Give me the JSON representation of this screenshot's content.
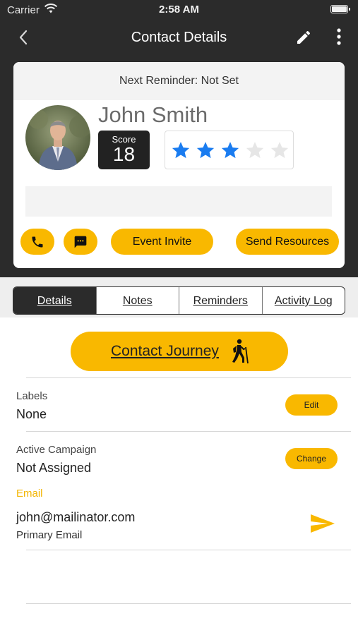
{
  "status_bar": {
    "carrier": "Carrier",
    "time": "2:58 AM"
  },
  "nav": {
    "title": "Contact Details"
  },
  "card": {
    "reminder": "Next Reminder:  Not Set",
    "name": "John Smith",
    "score_label": "Score",
    "score_value": "18",
    "rating": 3,
    "rating_max": 5,
    "event_invite": "Event Invite",
    "send_resources": "Send Resources"
  },
  "tabs": [
    "Details",
    "Notes",
    "Reminders",
    "Activity Log"
  ],
  "active_tab": "Details",
  "journey": {
    "label": "Contact Journey"
  },
  "labels": {
    "label": "Labels",
    "value": "None",
    "button": "Edit"
  },
  "campaign": {
    "label": "Active Campaign",
    "value": "Not Assigned",
    "button": "Change"
  },
  "email": {
    "label": "Email",
    "address": "john@mailinator.com",
    "type": "Primary Email"
  },
  "colors": {
    "accent": "#f9b800",
    "dark": "#2b2b2b",
    "star_filled": "#1a7cf0",
    "star_empty": "#e6e6e6"
  }
}
